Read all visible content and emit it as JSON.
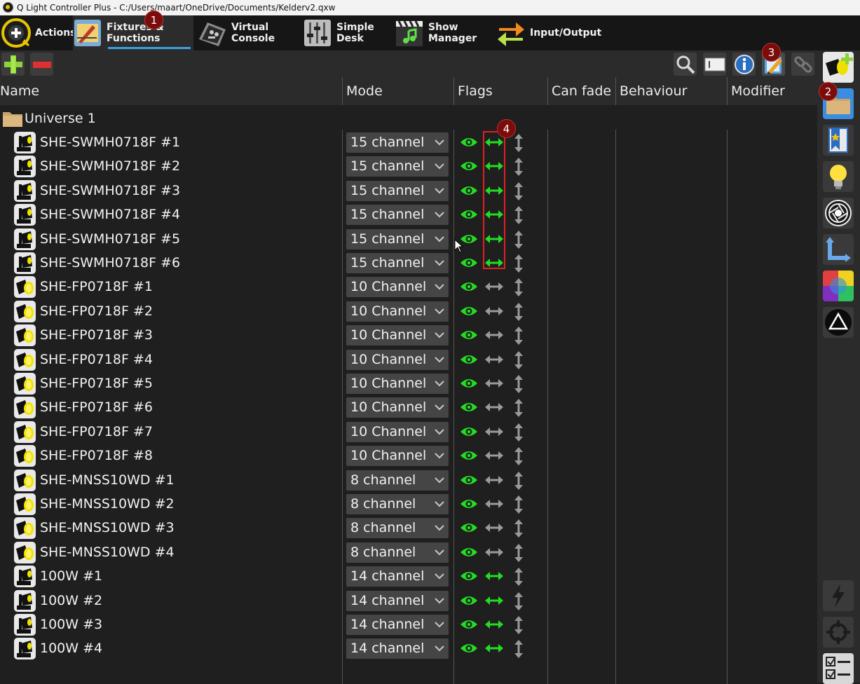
{
  "window": {
    "title": "Q Light Controller Plus - C:/Users/maart/OneDrive/Documents/Kelderv2.qxw"
  },
  "tabs": [
    {
      "label": "Actions"
    },
    {
      "label": "Fixtures & Functions",
      "active": true
    },
    {
      "label": "Virtual Console"
    },
    {
      "label": "Simple Desk"
    },
    {
      "label": "Show Manager"
    },
    {
      "label": "Input/Output"
    }
  ],
  "columns": [
    "Name",
    "Mode",
    "Flags",
    "Can fade",
    "Behaviour",
    "Modifier"
  ],
  "universe": {
    "name": "Universe 1"
  },
  "fixtures": [
    {
      "name": "SHE-SWMH0718F #1",
      "mode": "15 channel mode",
      "type": "moving-head",
      "h_active": true
    },
    {
      "name": "SHE-SWMH0718F #2",
      "mode": "15 channel mode",
      "type": "moving-head",
      "h_active": true
    },
    {
      "name": "SHE-SWMH0718F #3",
      "mode": "15 channel mode",
      "type": "moving-head",
      "h_active": true
    },
    {
      "name": "SHE-SWMH0718F #4",
      "mode": "15 channel mode",
      "type": "moving-head",
      "h_active": true
    },
    {
      "name": "SHE-SWMH0718F #5",
      "mode": "15 channel mode",
      "type": "moving-head",
      "h_active": true
    },
    {
      "name": "SHE-SWMH0718F #6",
      "mode": "15 channel mode",
      "type": "moving-head",
      "h_active": true
    },
    {
      "name": "SHE-FP0718F #1",
      "mode": "10 Channel",
      "type": "par",
      "h_active": false
    },
    {
      "name": "SHE-FP0718F #2",
      "mode": "10 Channel",
      "type": "par",
      "h_active": false
    },
    {
      "name": "SHE-FP0718F #3",
      "mode": "10 Channel",
      "type": "par",
      "h_active": false
    },
    {
      "name": "SHE-FP0718F #4",
      "mode": "10 Channel",
      "type": "par",
      "h_active": false
    },
    {
      "name": "SHE-FP0718F #5",
      "mode": "10 Channel",
      "type": "par",
      "h_active": false
    },
    {
      "name": "SHE-FP0718F #6",
      "mode": "10 Channel",
      "type": "par",
      "h_active": false
    },
    {
      "name": "SHE-FP0718F #7",
      "mode": "10 Channel",
      "type": "par",
      "h_active": false
    },
    {
      "name": "SHE-FP0718F #8",
      "mode": "10 Channel",
      "type": "par",
      "h_active": false
    },
    {
      "name": "SHE-MNSS10WD #1",
      "mode": "8 channel",
      "type": "par",
      "h_active": false
    },
    {
      "name": "SHE-MNSS10WD #2",
      "mode": "8 channel",
      "type": "par",
      "h_active": false
    },
    {
      "name": "SHE-MNSS10WD #3",
      "mode": "8 channel",
      "type": "par",
      "h_active": false
    },
    {
      "name": "SHE-MNSS10WD #4",
      "mode": "8 channel",
      "type": "par",
      "h_active": false
    },
    {
      "name": "100W #1",
      "mode": "14 channel",
      "type": "moving-head",
      "h_active": true
    },
    {
      "name": "100W #2",
      "mode": "14 channel",
      "type": "moving-head",
      "h_active": true
    },
    {
      "name": "100W #3",
      "mode": "14 channel",
      "type": "moving-head",
      "h_active": true
    },
    {
      "name": "100W #4",
      "mode": "14 channel",
      "type": "moving-head",
      "h_active": true
    }
  ],
  "annotations": [
    "1",
    "2",
    "3",
    "4"
  ],
  "colors": {
    "accent": "#3aa2e0",
    "flag_active": "#22dd22",
    "flag_inactive": "#9a9a9a",
    "badge": "#7a0c0c",
    "highlight": "#dd2222"
  },
  "icons": {
    "toolbar_left": [
      "add-fixture-icon",
      "remove-fixture-icon"
    ],
    "toolbar_right": [
      "search-icon",
      "rename-icon",
      "info-icon",
      "edit-icon",
      "link-icon"
    ],
    "sidebar": [
      "fixture-add-icon",
      "folder-icon",
      "bookmark-icon",
      "bulb-icon",
      "shutter-icon",
      "axis-icon",
      "color-icon",
      "triangle-icon",
      "flash-icon",
      "crosshair-icon",
      "checklist-icon"
    ]
  }
}
